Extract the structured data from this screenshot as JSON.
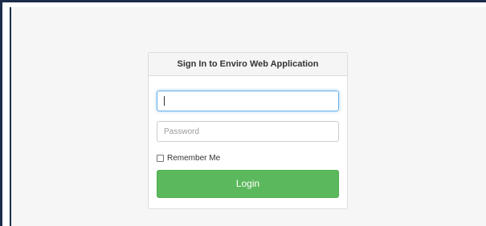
{
  "login_panel": {
    "title": "Sign In to Enviro Web Application",
    "username": {
      "value": "",
      "placeholder": ""
    },
    "password": {
      "value": "",
      "placeholder": "Password"
    },
    "remember_me_label": "Remember Me",
    "remember_me_checked": false,
    "login_label": "Login"
  },
  "colors": {
    "primary_button": "#5cb85c",
    "focus_border": "#66afe9",
    "window_border": "#1c2d4a",
    "page_background": "#f6f6f6"
  }
}
